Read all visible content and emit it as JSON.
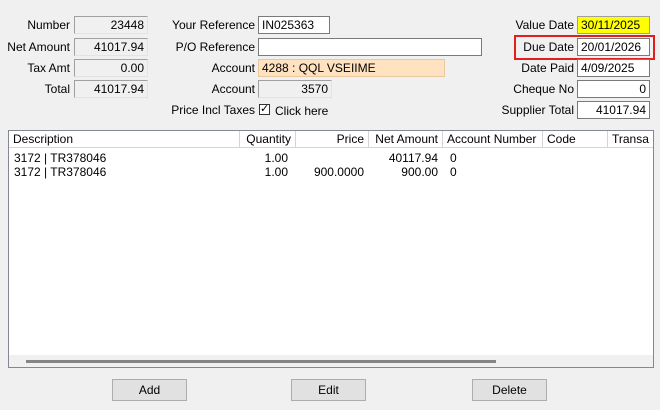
{
  "header": {
    "number": {
      "label": "Number",
      "value": "23448"
    },
    "net_amount": {
      "label": "Net Amount",
      "value": "41017.94"
    },
    "tax_amt": {
      "label": "Tax Amt",
      "value": "0.00"
    },
    "total": {
      "label": "Total",
      "value": "41017.94"
    },
    "your_reference": {
      "label": "Your Reference",
      "value": "IN025363"
    },
    "po_reference": {
      "label": "P/O Reference",
      "value": ""
    },
    "account_code": {
      "label": "Account",
      "value": "4288 : QQL VSEIIME"
    },
    "account_number": {
      "label": "Account",
      "value": "3570"
    },
    "price_incl_taxes": {
      "label": "Price Incl Taxes",
      "checked": true,
      "check_glyph": "✓",
      "link": "Click here"
    },
    "value_date": {
      "label": "Value Date",
      "value": "30/11/2025"
    },
    "due_date": {
      "label": "Due Date",
      "value": "20/01/2026"
    },
    "date_paid": {
      "label": "Date Paid",
      "value": "4/09/2025"
    },
    "cheque_no": {
      "label": "Cheque No",
      "value": "0"
    },
    "supplier_total": {
      "label": "Supplier Total",
      "value": "41017.94"
    }
  },
  "grid": {
    "columns": [
      "Description",
      "Quantity",
      "Price",
      "Net Amount",
      "Account Number",
      "Code",
      "Transa"
    ],
    "rows": [
      {
        "description": "3172 | TR378046",
        "quantity": "1.00",
        "price": "",
        "net_amount": "40117.94",
        "account_number": "0",
        "code": "",
        "transa": ""
      },
      {
        "description": "3172 | TR378046",
        "quantity": "1.00",
        "price": "900.0000",
        "net_amount": "900.00",
        "account_number": "0",
        "code": "",
        "transa": ""
      }
    ]
  },
  "buttons": {
    "add": "Add",
    "edit": "Edit",
    "delete": "Delete"
  },
  "colors": {
    "value_date_bg": "#ffff00",
    "account_bg": "#ffe2c0",
    "highlight_border": "#e02020"
  }
}
